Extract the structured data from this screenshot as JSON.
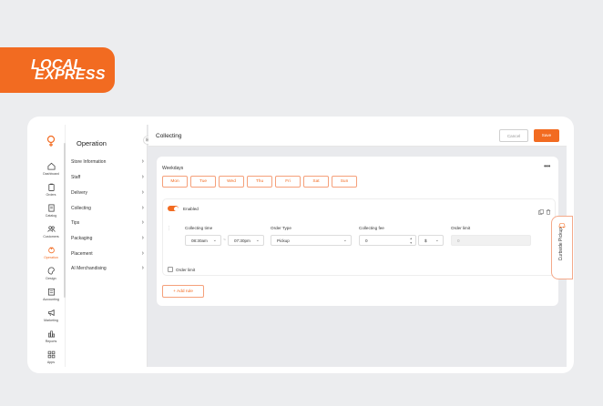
{
  "brand": {
    "line1": "LOCAL",
    "line2": "EXPRESS",
    "color": "#f26b21"
  },
  "colors": {
    "accent": "#f26b21",
    "accent_light": "#f5a07a",
    "background": "#e9eaed"
  },
  "nav": {
    "items": [
      {
        "id": "dashboard",
        "label": "Dashboard",
        "icon": "home-icon"
      },
      {
        "id": "orders",
        "label": "Orders",
        "icon": "clipboard-icon"
      },
      {
        "id": "catalog",
        "label": "Catalog",
        "icon": "book-icon"
      },
      {
        "id": "customers",
        "label": "Customers",
        "icon": "users-icon"
      },
      {
        "id": "operation",
        "label": "Operation",
        "icon": "operation-icon",
        "active": true
      },
      {
        "id": "design",
        "label": "Design",
        "icon": "palette-icon"
      },
      {
        "id": "accounting",
        "label": "Accounting",
        "icon": "ledger-icon"
      },
      {
        "id": "marketing",
        "label": "Marketing",
        "icon": "megaphone-icon"
      },
      {
        "id": "reports",
        "label": "Reports",
        "icon": "chart-icon"
      },
      {
        "id": "apps",
        "label": "Apps",
        "icon": "grid-icon"
      }
    ]
  },
  "operation_menu": {
    "title": "Operation",
    "items": [
      {
        "label": "Store Information"
      },
      {
        "label": "Staff"
      },
      {
        "label": "Delivery"
      },
      {
        "label": "Collecting"
      },
      {
        "label": "Tips"
      },
      {
        "label": "Packaging"
      },
      {
        "label": "Placement"
      },
      {
        "label": "AI Merchandising"
      }
    ]
  },
  "header": {
    "title": "Collecting",
    "cancel_label": "Cancel",
    "save_label": "Save"
  },
  "weekdays": {
    "title": "Weekdays",
    "more": "•••",
    "days": [
      "Mon",
      "Tue",
      "Wed",
      "Thu",
      "Fri",
      "Sat",
      "Sun"
    ]
  },
  "rule": {
    "enabled_label": "Enabled",
    "enabled": true,
    "collecting_time_label": "Collecting time",
    "time_start": "08:30am",
    "time_end": "07:30pm",
    "time_separator": "~",
    "order_type_label": "Order Type",
    "order_type_value": "Pickup",
    "fee_label": "Collecting fee",
    "fee_value": "0",
    "currency": "$",
    "order_limit_label": "Order limit",
    "order_limit_value": "0",
    "order_limit_checkbox_label": "Order limit"
  },
  "add_rule_label": "Add rule",
  "curbside": {
    "label": "Curbside Pickup",
    "icon": "curbside-icon"
  }
}
